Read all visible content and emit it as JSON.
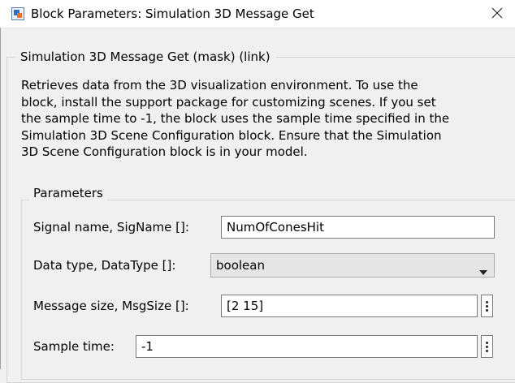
{
  "window": {
    "title": "Block Parameters: Simulation 3D Message Get",
    "close_glyph": "✕",
    "icon": "simulink-block-icon"
  },
  "mask": {
    "title": "Simulation 3D Message Get (mask) (link)",
    "description_lines": [
      "Retrieves data from the 3D visualization environment. To use the",
      "block, install the support package for customizing scenes. If you set",
      "the sample time to -1, the block uses the sample time specified in the",
      "Simulation 3D Scene Configuration block. Ensure that the Simulation",
      "3D Scene Configuration block is in your model."
    ]
  },
  "parameters": {
    "group_label": "Parameters",
    "signal_name": {
      "label": "Signal name, SigName []:",
      "value": "NumOfConesHit"
    },
    "data_type": {
      "label": "Data type, DataType []:",
      "value": "boolean"
    },
    "message_size": {
      "label": "Message size, MsgSize []:",
      "value": "[2 15]"
    },
    "sample_time": {
      "label": "Sample time:",
      "value": "-1"
    }
  },
  "colors": {
    "background": "#f0f0f0",
    "titlebar": "#ffffff",
    "border": "#7a7a7a",
    "select_bg": "#e5e5e5"
  }
}
